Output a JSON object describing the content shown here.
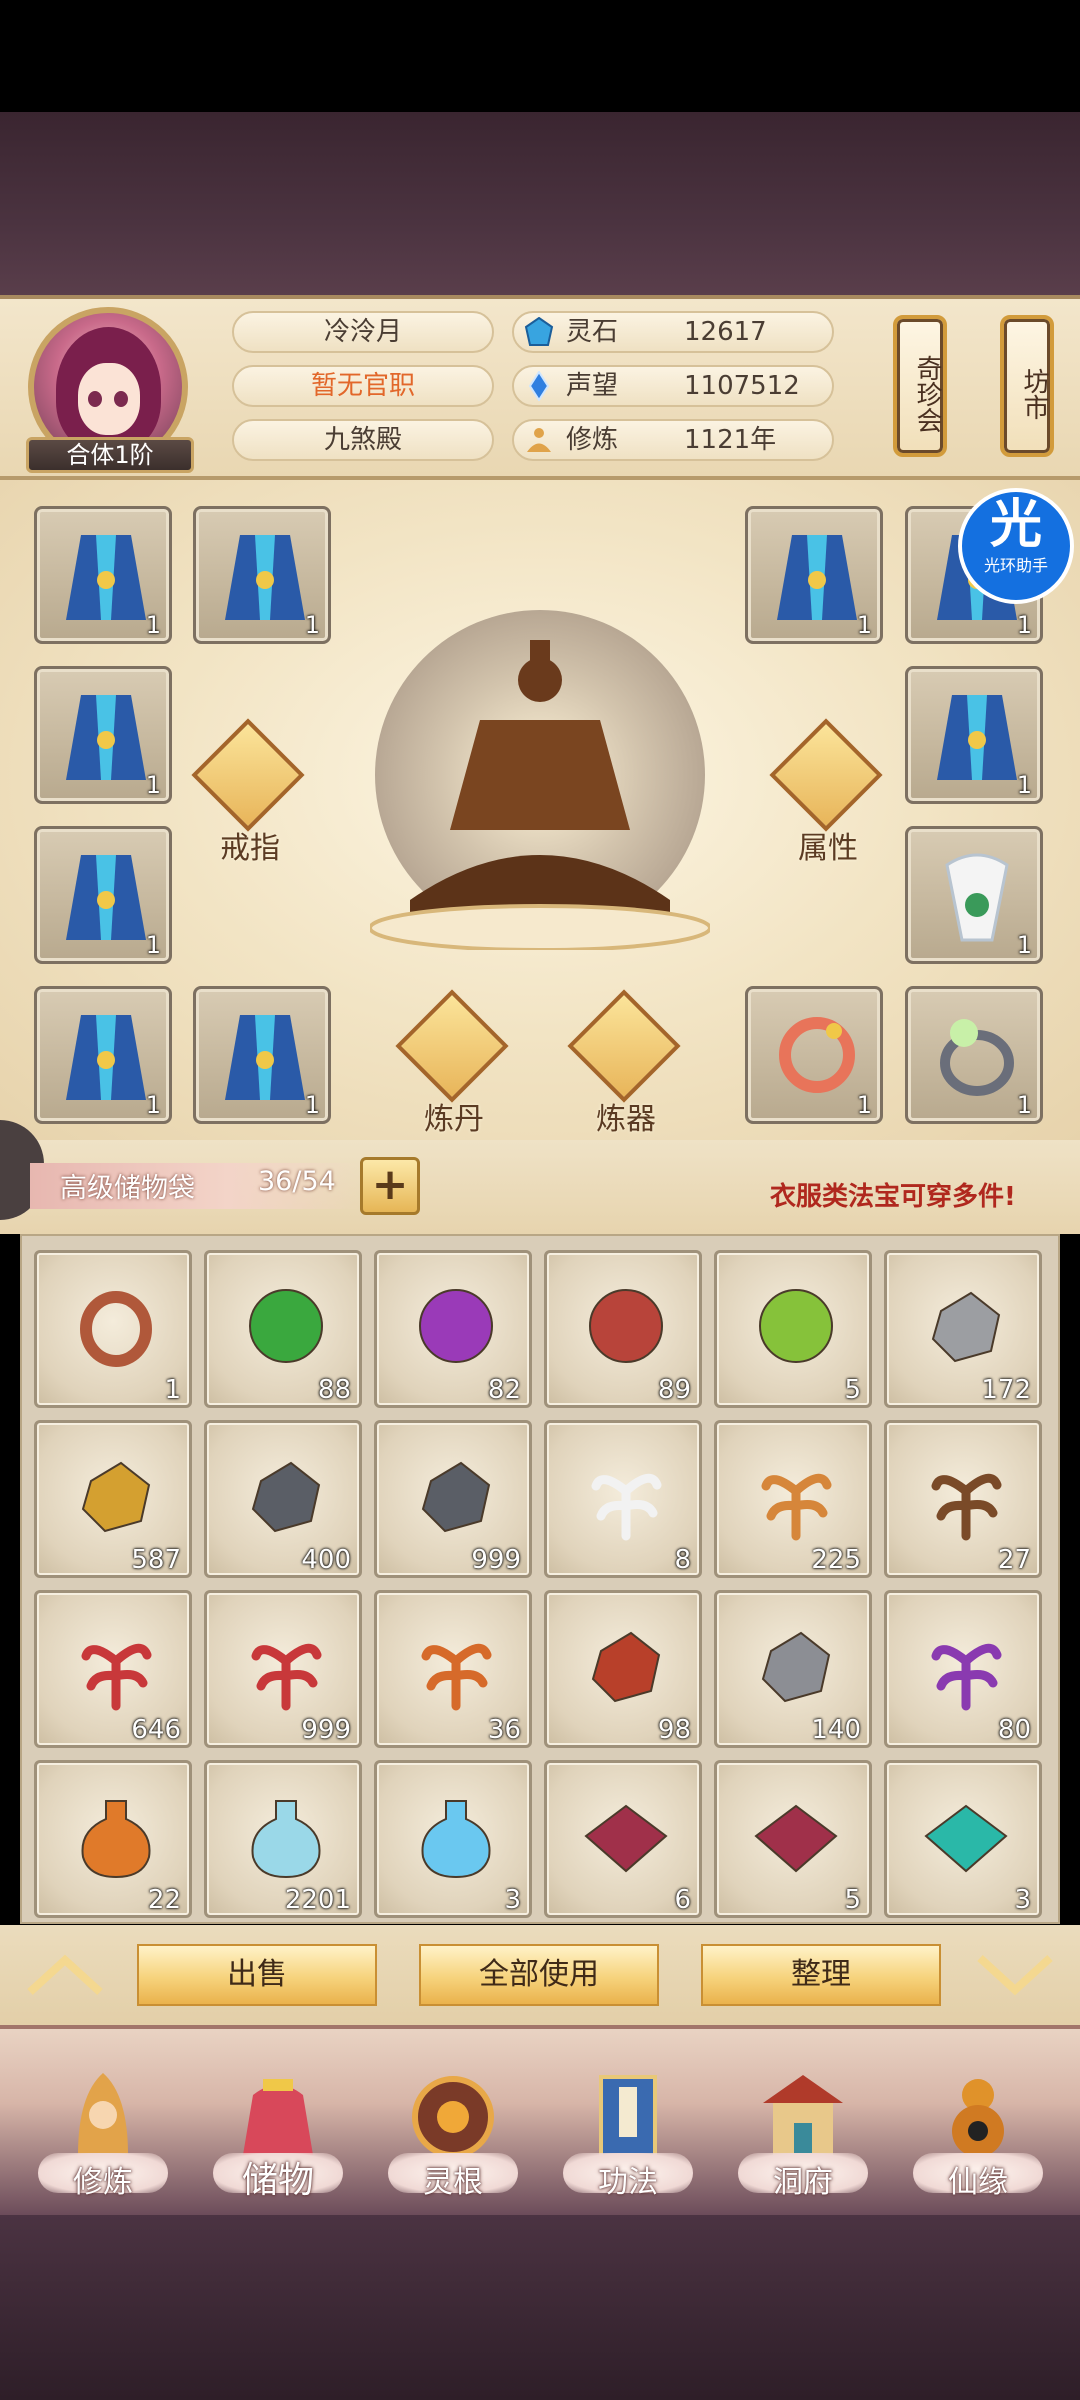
{
  "player": {
    "name": "冷泠月",
    "title": "暂无官职",
    "sect": "九煞殿",
    "rank": "合体1阶"
  },
  "stats": [
    {
      "label": "灵石",
      "value": "12617",
      "icon": "spirit-stone-icon",
      "color": "#38a4e0"
    },
    {
      "label": "声望",
      "value": "1107512",
      "icon": "reputation-icon",
      "color": "#2f7fe0"
    },
    {
      "label": "修炼",
      "value": "1121年",
      "icon": "cultivation-icon",
      "color": "#e0a34a"
    }
  ],
  "side_buttons": {
    "treasure": "奇珍会",
    "market": "坊市"
  },
  "helper": {
    "big": "光",
    "small": "光环助手"
  },
  "equip_buttons": {
    "ring": "戒指",
    "attr": "属性",
    "alchemy": "炼丹",
    "forge": "炼器"
  },
  "equip_slots": [
    {
      "icon": "robe-icon",
      "count": "1"
    },
    {
      "icon": "robe-icon",
      "count": "1"
    },
    {
      "icon": "robe-icon",
      "count": "1"
    },
    {
      "icon": "robe-icon",
      "count": "1"
    },
    {
      "icon": "robe-icon",
      "count": "1"
    },
    {
      "icon": "robe-icon",
      "count": "1"
    },
    {
      "icon": "robe-icon",
      "count": "1"
    },
    {
      "icon": "feather-armor-icon",
      "count": "1"
    },
    {
      "icon": "robe-icon",
      "count": "1"
    },
    {
      "icon": "robe-icon",
      "count": "1"
    },
    {
      "icon": "dragon-bracelet-icon",
      "count": "1"
    },
    {
      "icon": "pearl-ring-icon",
      "count": "1"
    }
  ],
  "bag": {
    "name": "高级储物袋",
    "capacity": "36/54",
    "add": "+",
    "notice": "衣服类法宝可穿多件!"
  },
  "inventory": [
    {
      "icon": "ring-icon",
      "count": "1",
      "color": "#b0583a"
    },
    {
      "icon": "green-orb-icon",
      "count": "88",
      "color": "#3aa83e"
    },
    {
      "icon": "purple-orb-icon",
      "count": "82",
      "color": "#9a3ab8"
    },
    {
      "icon": "red-orb-icon",
      "count": "89",
      "color": "#b8443a"
    },
    {
      "icon": "lime-orb-icon",
      "count": "5",
      "color": "#86c23a"
    },
    {
      "icon": "gray-ore-icon",
      "count": "172",
      "color": "#9c9ea2"
    },
    {
      "icon": "gold-ore-icon",
      "count": "587",
      "color": "#d4a030"
    },
    {
      "icon": "iron-ore-icon",
      "count": "400",
      "color": "#5a5e66"
    },
    {
      "icon": "iron-ore-icon",
      "count": "999",
      "color": "#5a5e66"
    },
    {
      "icon": "white-flower-icon",
      "count": "8",
      "color": "#f2f2f2"
    },
    {
      "icon": "ginseng-icon",
      "count": "225",
      "color": "#d6863a"
    },
    {
      "icon": "root-herb-icon",
      "count": "27",
      "color": "#7a4a28"
    },
    {
      "icon": "red-herb-icon",
      "count": "646",
      "color": "#c8383a"
    },
    {
      "icon": "red-herb-icon",
      "count": "999",
      "color": "#c8383a"
    },
    {
      "icon": "orange-root-icon",
      "count": "36",
      "color": "#d66a2a"
    },
    {
      "icon": "red-crystal-icon",
      "count": "98",
      "color": "#b8402a"
    },
    {
      "icon": "silver-stone-icon",
      "count": "140",
      "color": "#8c8e94"
    },
    {
      "icon": "purple-berry-icon",
      "count": "80",
      "color": "#8a3ab0"
    },
    {
      "icon": "gourd-icon",
      "count": "22",
      "color": "#e07a2a"
    },
    {
      "icon": "potion-bottle-icon",
      "count": "2201",
      "color": "#9ad8e8"
    },
    {
      "icon": "tea-bowl-icon",
      "count": "3",
      "color": "#6ac8f0"
    },
    {
      "icon": "rice-cloth-icon",
      "count": "6",
      "color": "#a0304a"
    },
    {
      "icon": "rice-cloth-icon",
      "count": "5",
      "color": "#a0304a"
    },
    {
      "icon": "teal-seed-cloth-icon",
      "count": "3",
      "color": "#2ab8a8"
    }
  ],
  "actions": {
    "sell": "出售",
    "use_all": "全部使用",
    "sort": "整理"
  },
  "nav": [
    {
      "label": "修炼",
      "icon": "cultivate-monk-icon"
    },
    {
      "label": "储物",
      "icon": "storage-bag-icon"
    },
    {
      "label": "灵根",
      "icon": "spirit-root-icon"
    },
    {
      "label": "功法",
      "icon": "technique-book-icon"
    },
    {
      "label": "洞府",
      "icon": "cave-house-icon"
    },
    {
      "label": "仙缘",
      "icon": "fate-gourd-icon"
    }
  ]
}
